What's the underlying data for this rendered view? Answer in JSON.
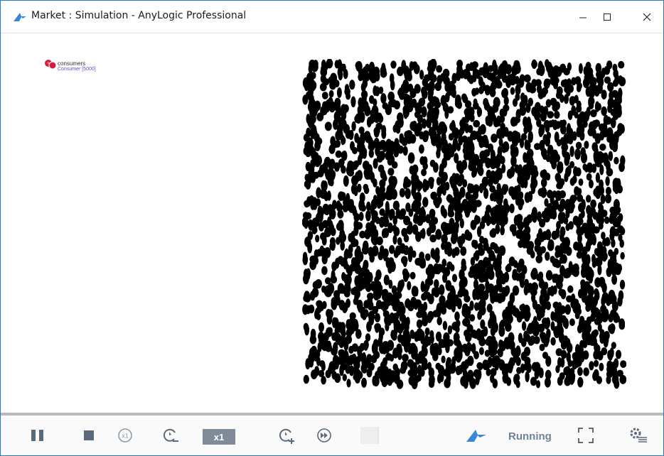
{
  "window": {
    "title": "Market : Simulation - AnyLogic Professional",
    "controls": {
      "minimize_icon": "minimize-icon",
      "maximize_icon": "maximize-icon",
      "close_icon": "close-icon"
    }
  },
  "canvas": {
    "population": {
      "name": "consumers",
      "type_count": "Consumer [5000]",
      "icon": "agent-population-icon"
    },
    "agents_color": "#000000"
  },
  "controlbar": {
    "speed_label": "x1",
    "status": "Running",
    "icons": [
      "pause-icon",
      "stop-icon",
      "run-x1-icon",
      "slow-down-icon",
      "speed-up-icon",
      "run-fast-icon",
      "progress-slot",
      "anylogic-logo-icon",
      "fullscreen-icon",
      "settings-icon"
    ]
  },
  "colors": {
    "accent": "#2b79c2",
    "status": "#6f8396",
    "speed_bg": "#7f8b99"
  }
}
